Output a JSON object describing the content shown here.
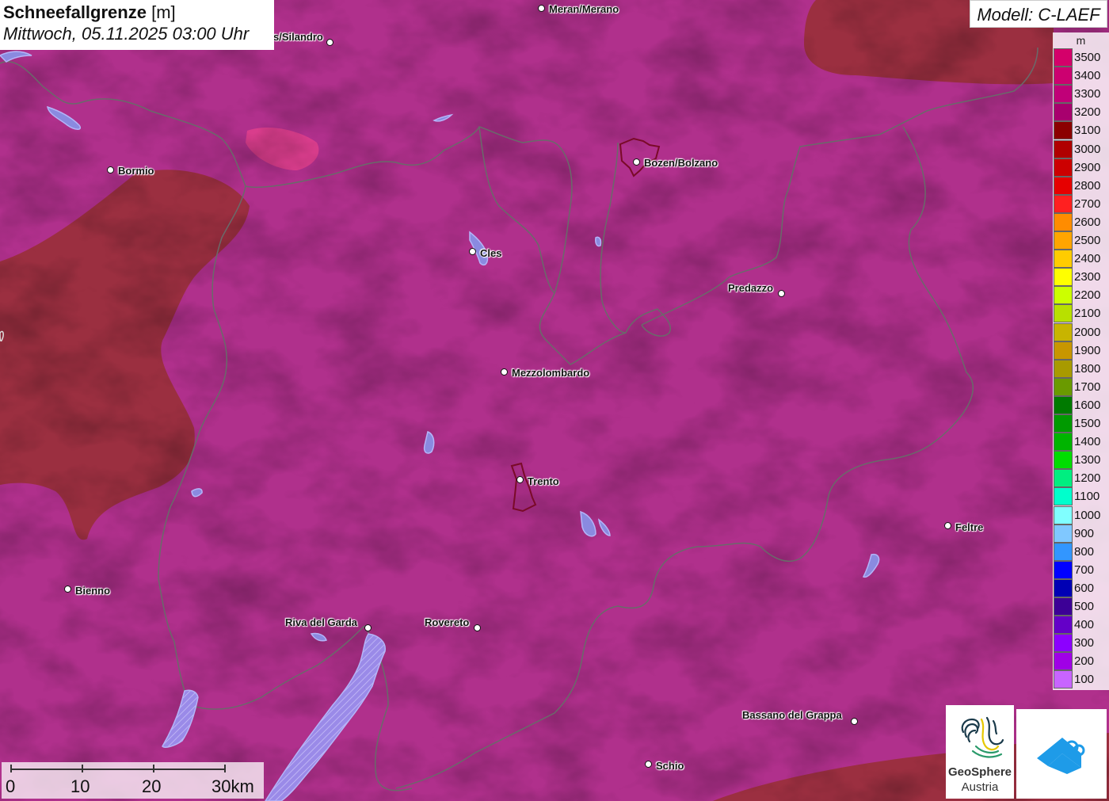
{
  "header": {
    "title": "Schneefallgrenze",
    "unit": "[m]",
    "datetime": "Mittwoch, 05.11.2025 03:00 Uhr"
  },
  "model": {
    "label": "Modell: C-LAEF"
  },
  "legend": {
    "unit": "m",
    "levels": [
      {
        "value": "3500",
        "color": "#d4006a"
      },
      {
        "value": "3400",
        "color": "#cc0070"
      },
      {
        "value": "3300",
        "color": "#c00078"
      },
      {
        "value": "3200",
        "color": "#a8006e"
      },
      {
        "value": "3100",
        "color": "#8b0000"
      },
      {
        "value": "3000",
        "color": "#b00000"
      },
      {
        "value": "2900",
        "color": "#cc0000"
      },
      {
        "value": "2800",
        "color": "#e60000"
      },
      {
        "value": "2700",
        "color": "#ff2020"
      },
      {
        "value": "2600",
        "color": "#ff8c00"
      },
      {
        "value": "2500",
        "color": "#ffa500"
      },
      {
        "value": "2400",
        "color": "#ffcc00"
      },
      {
        "value": "2300",
        "color": "#ffff00"
      },
      {
        "value": "2200",
        "color": "#ccff00"
      },
      {
        "value": "2100",
        "color": "#b8e000"
      },
      {
        "value": "2000",
        "color": "#c8b400"
      },
      {
        "value": "1900",
        "color": "#c89600"
      },
      {
        "value": "1800",
        "color": "#a89a00"
      },
      {
        "value": "1700",
        "color": "#6a9a00"
      },
      {
        "value": "1600",
        "color": "#007a00"
      },
      {
        "value": "1500",
        "color": "#009a00"
      },
      {
        "value": "1400",
        "color": "#00b400"
      },
      {
        "value": "1300",
        "color": "#00dd00"
      },
      {
        "value": "1200",
        "color": "#00ee80"
      },
      {
        "value": "1100",
        "color": "#00ffcc"
      },
      {
        "value": "1000",
        "color": "#80ffff"
      },
      {
        "value": "900",
        "color": "#80c8ff"
      },
      {
        "value": "800",
        "color": "#3296ff"
      },
      {
        "value": "700",
        "color": "#0000ff"
      },
      {
        "value": "600",
        "color": "#0000b4"
      },
      {
        "value": "500",
        "color": "#3c0096"
      },
      {
        "value": "400",
        "color": "#6400c8"
      },
      {
        "value": "300",
        "color": "#8c00ff"
      },
      {
        "value": "200",
        "color": "#a000e6"
      },
      {
        "value": "100",
        "color": "#c864ff"
      }
    ]
  },
  "cities": [
    {
      "name": "Meran/Merano"
    },
    {
      "name": "s/Silandro"
    },
    {
      "name": "Bormio"
    },
    {
      "name": "Bozen/Bolzano"
    },
    {
      "name": "Cles"
    },
    {
      "name": "Predazzo"
    },
    {
      "name": "Mezzolombardo"
    },
    {
      "name": "Trento"
    },
    {
      "name": "Feltre"
    },
    {
      "name": "Bienno"
    },
    {
      "name": "Riva del Garda"
    },
    {
      "name": "Rovereto"
    },
    {
      "name": "Bassano del Grappa"
    },
    {
      "name": "Schio"
    }
  ],
  "scale": {
    "labels": [
      "0",
      "10",
      "20",
      "30km"
    ]
  },
  "logos": {
    "geosphere_line1": "GeoSphere",
    "geosphere_line2": "Austria"
  },
  "colors": {
    "map_fill": "#b0308c",
    "high_zone": "#9a2f3c",
    "pink_patch": "#e0408c",
    "water": "#8a8ae0",
    "border_line": "#6a6a6a",
    "outline_dark": "#7a0a28"
  }
}
